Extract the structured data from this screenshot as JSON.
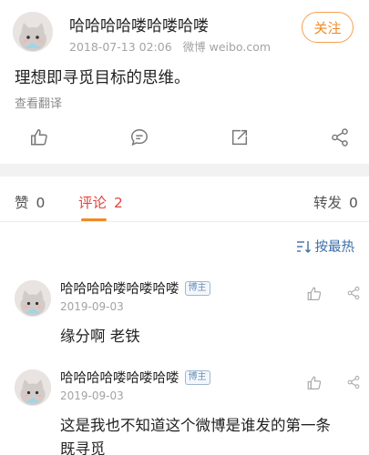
{
  "post": {
    "author": "哈哈哈哈喽哈喽哈喽",
    "date": "2018-07-13 02:06",
    "source": "微博 weibo.com",
    "follow_label": "关注",
    "text": "理想即寻觅目标的思维。",
    "translate_label": "查看翻译",
    "actions": [
      "like-icon",
      "comment-icon",
      "repost-icon",
      "share-icon"
    ]
  },
  "tabs": {
    "likes_label": "赞",
    "likes_count": "0",
    "comments_label": "评论",
    "comments_count": "2",
    "reposts_label": "转发",
    "reposts_count": "0"
  },
  "sort": {
    "label": "按最热"
  },
  "comments": [
    {
      "author": "哈哈哈哈喽哈喽哈喽",
      "badge": "博主",
      "date": "2019-09-03",
      "lines": [
        "缘分啊 老铁"
      ]
    },
    {
      "author": "哈哈哈哈喽哈喽哈喽",
      "badge": "博主",
      "date": "2019-09-03",
      "lines": [
        "这是我也不知道这个微博是谁发的第一条",
        "既寻觅"
      ]
    }
  ],
  "colors": {
    "accent_orange": "#f08a24",
    "active_red": "#e0453c",
    "link_blue": "#3b6ea8"
  }
}
